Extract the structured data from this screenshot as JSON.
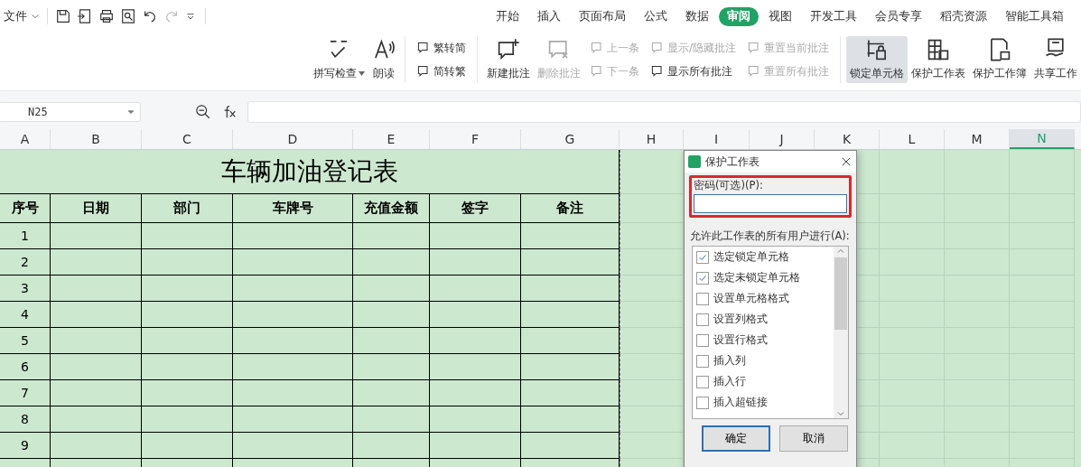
{
  "quick_access": {
    "file_menu": "文件"
  },
  "menu_tabs": [
    {
      "label": "开始",
      "selected": false
    },
    {
      "label": "插入",
      "selected": false
    },
    {
      "label": "页面布局",
      "selected": false
    },
    {
      "label": "公式",
      "selected": false
    },
    {
      "label": "数据",
      "selected": false
    },
    {
      "label": "审阅",
      "selected": true
    },
    {
      "label": "视图",
      "selected": false
    },
    {
      "label": "开发工具",
      "selected": false
    },
    {
      "label": "会员专享",
      "selected": false
    },
    {
      "label": "稻壳资源",
      "selected": false
    },
    {
      "label": "智能工具箱",
      "selected": false
    }
  ],
  "ribbon": [
    {
      "kind": "large",
      "label": "拼写检查",
      "caret": true,
      "disabled": false,
      "selected": false
    },
    {
      "kind": "large",
      "label": "朗读",
      "caret": false,
      "disabled": false,
      "selected": false
    },
    {
      "kind": "stack",
      "items": [
        {
          "label": "繁转简",
          "disabled": false
        },
        {
          "label": "简转繁",
          "disabled": false
        }
      ]
    },
    {
      "kind": "large",
      "label": "新建批注",
      "caret": false,
      "disabled": false,
      "selected": false
    },
    {
      "kind": "large",
      "label": "删除批注",
      "caret": false,
      "disabled": true,
      "selected": false
    },
    {
      "kind": "stack",
      "items": [
        {
          "label": "上一条",
          "disabled": true
        },
        {
          "label": "下一条",
          "disabled": true
        }
      ]
    },
    {
      "kind": "stack",
      "items": [
        {
          "label": "显示/隐藏批注",
          "disabled": true
        },
        {
          "label": "显示所有批注",
          "disabled": false
        }
      ]
    },
    {
      "kind": "stack",
      "items": [
        {
          "label": "重置当前批注",
          "disabled": true
        },
        {
          "label": "重置所有批注",
          "disabled": true
        }
      ]
    },
    {
      "kind": "large",
      "label": "锁定单元格",
      "caret": false,
      "disabled": false,
      "selected": true
    },
    {
      "kind": "large",
      "label": "保护工作表",
      "caret": false,
      "disabled": false,
      "selected": false
    },
    {
      "kind": "large",
      "label": "保护工作簿",
      "caret": false,
      "disabled": false,
      "selected": false
    },
    {
      "kind": "large",
      "label": "共享工作",
      "caret": false,
      "disabled": false,
      "selected": false
    }
  ],
  "formula_bar": {
    "name_box": "N25"
  },
  "columns": [
    {
      "label": "A",
      "selected": false
    },
    {
      "label": "B",
      "selected": false
    },
    {
      "label": "C",
      "selected": false
    },
    {
      "label": "D",
      "selected": false
    },
    {
      "label": "E",
      "selected": false
    },
    {
      "label": "F",
      "selected": false
    },
    {
      "label": "G",
      "selected": false
    },
    {
      "label": "H",
      "selected": false
    },
    {
      "label": "I",
      "selected": false
    },
    {
      "label": "J",
      "selected": false
    },
    {
      "label": "K",
      "selected": false
    },
    {
      "label": "L",
      "selected": false
    },
    {
      "label": "M",
      "selected": false
    },
    {
      "label": "N",
      "selected": true
    }
  ],
  "sheet": {
    "title": "车辆加油登记表",
    "headers": [
      "序号",
      "日期",
      "部门",
      "车牌号",
      "充值金额",
      "签字",
      "备注"
    ],
    "row_numbers": [
      "1",
      "2",
      "3",
      "4",
      "5",
      "6",
      "7",
      "8",
      "9"
    ]
  },
  "dialog": {
    "title": "保护工作表",
    "password_label": "密码(可选)(P):",
    "allow_label": "允许此工作表的所有用户进行(A):",
    "permissions": [
      {
        "label": "选定锁定单元格",
        "checked": true
      },
      {
        "label": "选定未锁定单元格",
        "checked": true
      },
      {
        "label": "设置单元格格式",
        "checked": false
      },
      {
        "label": "设置列格式",
        "checked": false
      },
      {
        "label": "设置行格式",
        "checked": false
      },
      {
        "label": "插入列",
        "checked": false
      },
      {
        "label": "插入行",
        "checked": false
      },
      {
        "label": "插入超链接",
        "checked": false
      }
    ],
    "buttons": [
      {
        "label": "确定",
        "kind": "primary"
      },
      {
        "label": "取消",
        "kind": "secondary"
      }
    ]
  }
}
